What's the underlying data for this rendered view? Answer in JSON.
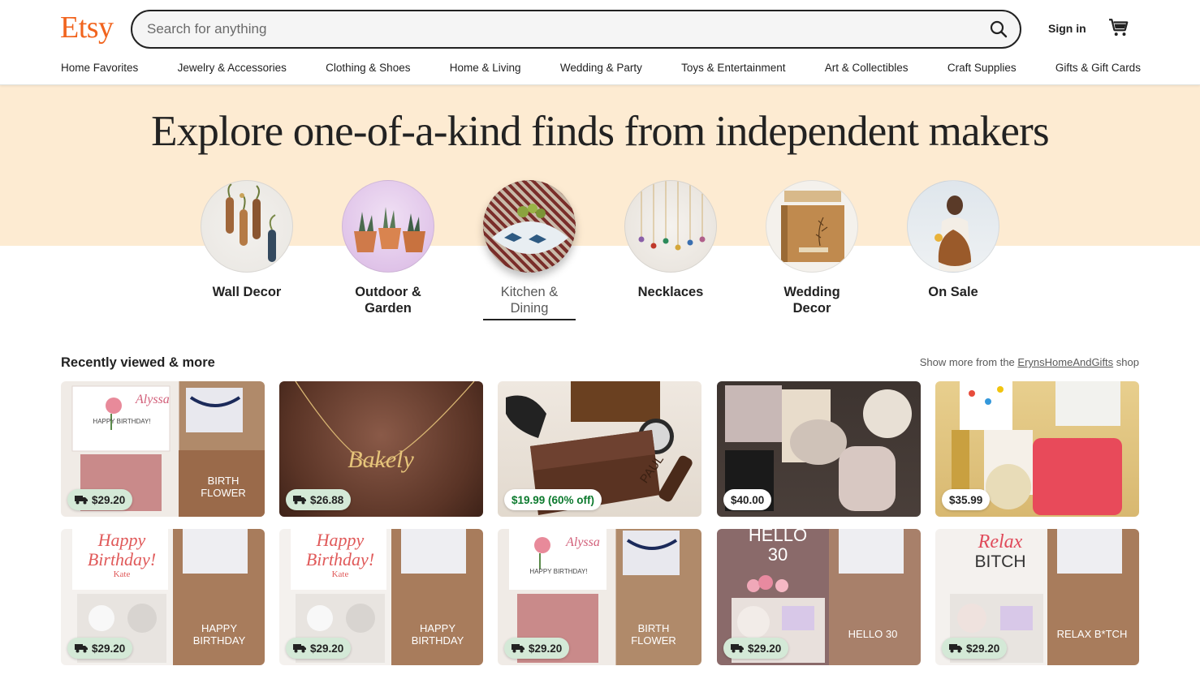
{
  "header": {
    "logo": "Etsy",
    "search_placeholder": "Search for anything",
    "signin_label": "Sign in",
    "cart_icon": "cart-icon",
    "search_icon": "search-icon",
    "brand_color": "#f1641e"
  },
  "nav": [
    "Home Favorites",
    "Jewelry & Accessories",
    "Clothing & Shoes",
    "Home & Living",
    "Wedding & Party",
    "Toys & Entertainment",
    "Art & Collectibles",
    "Craft Supplies",
    "Gifts & Gift Cards"
  ],
  "hero": {
    "title": "Explore one-of-a-kind finds from independent makers",
    "background": "#fdebd2"
  },
  "categories": [
    {
      "label": "Wall Decor",
      "active": false
    },
    {
      "label": "Outdoor & Garden",
      "active": false
    },
    {
      "label": "Kitchen & Dining",
      "active": true
    },
    {
      "label": "Necklaces",
      "active": false
    },
    {
      "label": "Wedding Decor",
      "active": false
    },
    {
      "label": "On Sale",
      "active": false
    }
  ],
  "recent": {
    "title": "Recently viewed & more",
    "show_more_prefix": "Show more from the",
    "shop_link": "ErynsHomeAndGifts",
    "show_more_suffix": "shop",
    "row1": [
      {
        "price": "$29.20",
        "free_shipping": true,
        "caption": "BIRTH FLOWER",
        "name": "Alyssa",
        "greeting": "HAPPY BIRTHDAY!"
      },
      {
        "price": "$26.88",
        "free_shipping": true,
        "name": "Bakely"
      },
      {
        "price": "$19.99 (60% off)",
        "free_shipping": false,
        "sale": true,
        "name": "PAUL"
      },
      {
        "price": "$40.00",
        "free_shipping": false
      },
      {
        "price": "$35.99",
        "free_shipping": false
      }
    ],
    "row2": [
      {
        "price": "$29.20",
        "free_shipping": true,
        "caption": "HAPPY BIRTHDAY",
        "name": "Kate",
        "headline": "Happy Birthday!"
      },
      {
        "price": "$29.20",
        "free_shipping": true,
        "caption": "HAPPY BIRTHDAY",
        "name": "Kate",
        "headline": "Happy Birthday!"
      },
      {
        "price": "$29.20",
        "free_shipping": true,
        "caption": "BIRTH FLOWER",
        "name": "Alyssa",
        "greeting": "HAPPY BIRTHDAY!"
      },
      {
        "price": "$29.20",
        "free_shipping": true,
        "caption": "HELLO 30",
        "headline": "HELLO 30"
      },
      {
        "price": "$29.20",
        "free_shipping": true,
        "caption": "RELAX B*TCH",
        "headline": "Relax BITCH"
      }
    ]
  }
}
